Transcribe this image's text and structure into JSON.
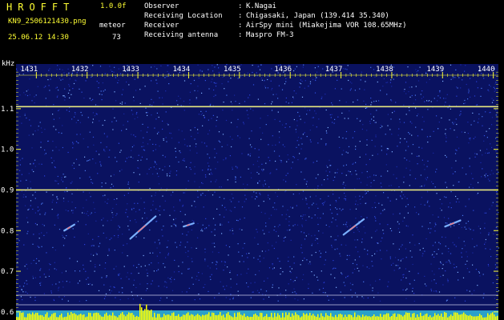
{
  "header": {
    "logo": "HROFFT",
    "version": "1.0.0f",
    "filename": "KN9_2506121430.png",
    "datetime": "25.06.12 14:30",
    "meteor_label": "meteor",
    "meteor_count": "73"
  },
  "info": [
    {
      "key": "Observer",
      "value": "K.Nagai"
    },
    {
      "key": "Receiving Location",
      "value": "Chigasaki, Japan (139.414 35.340)"
    },
    {
      "key": "Receiver",
      "value": "AirSpy mini (Miakejima VOR 108.65MHz)"
    },
    {
      "key": "Receiving antenna",
      "value": "Maspro FM-3"
    }
  ],
  "separator": ":",
  "colors": {
    "accent": "#ffff33",
    "background_noise": "#0a1260",
    "band_line": "#e8e880",
    "histogram": "#ffff00"
  },
  "chart_data": {
    "type": "heatmap",
    "yunit": "kHz",
    "x_ticks": [
      "1431",
      "1432",
      "1433",
      "1434",
      "1435",
      "1436",
      "1437",
      "1438",
      "1439",
      "1440"
    ],
    "y_ticks": [
      "1.1",
      "1.0",
      "0.9",
      "0.8",
      "0.7",
      "0.6"
    ],
    "ylim": [
      0.58,
      1.21
    ],
    "xlim": [
      1430.6,
      1440.1
    ],
    "carrier_lines_khz": [
      1.105,
      0.9
    ],
    "meteor_echoes": [
      {
        "t0": 1431.55,
        "t1": 1431.75,
        "f0": 0.8,
        "f1": 0.815
      },
      {
        "t0": 1432.85,
        "t1": 1433.35,
        "f0": 0.78,
        "f1": 0.835
      },
      {
        "t0": 1433.9,
        "t1": 1434.1,
        "f0": 0.81,
        "f1": 0.818
      },
      {
        "t0": 1437.05,
        "t1": 1437.45,
        "f0": 0.79,
        "f1": 0.828
      },
      {
        "t0": 1439.05,
        "t1": 1439.35,
        "f0": 0.81,
        "f1": 0.825
      }
    ]
  }
}
